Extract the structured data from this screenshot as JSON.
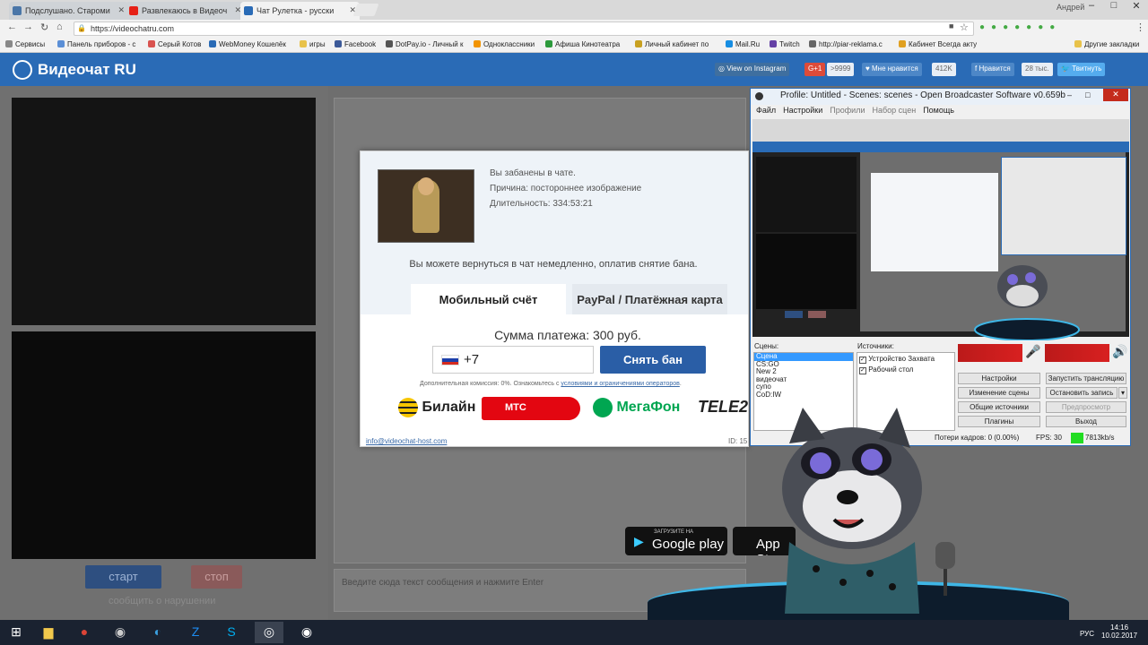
{
  "browser": {
    "tabs": [
      {
        "title": "Подслушано. Староми",
        "color": "#4a76a8"
      },
      {
        "title": "Развлекаюсь в Видеоч",
        "color": "#e62117"
      },
      {
        "title": "Чат Рулетка - русски",
        "color": "#2a6bb6"
      }
    ],
    "user": "Андрей",
    "url": "https://videochatru.com",
    "bookmarks": [
      {
        "label": "Сервисы",
        "color": "#888"
      },
      {
        "label": "Панель приборов - с",
        "color": "#5b8fd6"
      },
      {
        "label": "Серый Котов",
        "color": "#d9534f"
      },
      {
        "label": "WebMoney Кошелёк",
        "color": "#2a6bb6"
      },
      {
        "label": "игры",
        "color": "#e8c24a"
      },
      {
        "label": "Facebook",
        "color": "#3b5998"
      },
      {
        "label": "DotPay.io - Личный к",
        "color": "#555"
      },
      {
        "label": "Одноклассники",
        "color": "#f29400"
      },
      {
        "label": "Афиша Кинотеатра",
        "color": "#2c9a3c"
      },
      {
        "label": "Личный кабинет по",
        "color": "#c8a020"
      },
      {
        "label": "Mail.Ru",
        "color": "#168de2"
      },
      {
        "label": "Twitch",
        "color": "#6441a5"
      },
      {
        "label": "http://piar-reklama.c",
        "color": "#666"
      },
      {
        "label": "Кабинет Всегда акту",
        "color": "#e0a020"
      },
      {
        "label": "Другие закладки",
        "color": "#e8c24a"
      }
    ]
  },
  "site": {
    "logo": "Видеочат RU",
    "social": {
      "instagram": "View on Instagram",
      "gplus": "G+1",
      "gplus_count": ">9999",
      "like": "Мне нравится",
      "like_count": "412K",
      "fb": "Нравится",
      "fb_count": "28 тыс.",
      "tweet": "Твитнуть"
    },
    "start": "старт",
    "stop": "стоп",
    "report": "сообщить о нарушении",
    "chat_placeholder": "Введите сюда текст сообщения и нажмите Enter",
    "stores": [
      {
        "small": "ЗАГРУЗИТЕ НА",
        "big": "Google play"
      },
      {
        "small": "",
        "big": "App St"
      }
    ]
  },
  "modal": {
    "banned": "Вы забанены в чате.",
    "reason": "Причина: постороннее изображение",
    "duration": "Длительность: 334:53:21",
    "comeback": "Вы можете вернуться в чат немедленно, оплатив снятие бана.",
    "tab_mobile": "Мобильный счёт",
    "tab_paypal": "PayPal / Платёжная карта",
    "sum": "Сумма платежа: 300 руб.",
    "phone_prefix": "+7",
    "unban": "Снять бан",
    "commission": "Дополнительная комиссия: 0%. Ознакомьтесь с",
    "commission_link": "условиями и ограничениями операторов",
    "operators": [
      {
        "name": "Билайн",
        "color": "#222"
      },
      {
        "name": "МТС",
        "color": "#fff"
      },
      {
        "name": "МегаФон",
        "color": "#00a651"
      },
      {
        "name": "TELE2",
        "color": "#222"
      }
    ],
    "email": "info@videochat-host.com",
    "id_label": "ID: 15"
  },
  "obs": {
    "title": "Profile: Untitled - Scenes: scenes - Open Broadcaster Software v0.659b",
    "menu": [
      "Файл",
      "Настройки",
      "Профили",
      "Набор сцен",
      "Помощь"
    ],
    "scenes_label": "Сцены:",
    "scenes": [
      "Сцена",
      "CS:GO",
      "New 2",
      "видеочат",
      "супо",
      "CoD:IW"
    ],
    "sources_label": "Источники:",
    "sources": [
      "Устройство Захвата",
      "Рабочий стол"
    ],
    "buttons": [
      "Настройки",
      "Запустить трансляцию",
      "Изменение сцены",
      "Остановить запись",
      "Общие источники",
      "Предпросмотр",
      "Плагины",
      "Выход"
    ],
    "dropped": "Потери кадров: 0 (0.00%)",
    "fps": "FPS: 30",
    "bitrate": "7813kb/s"
  },
  "taskbar": {
    "lang": "РУС",
    "time": "14:16",
    "date": "10.02.2017"
  }
}
